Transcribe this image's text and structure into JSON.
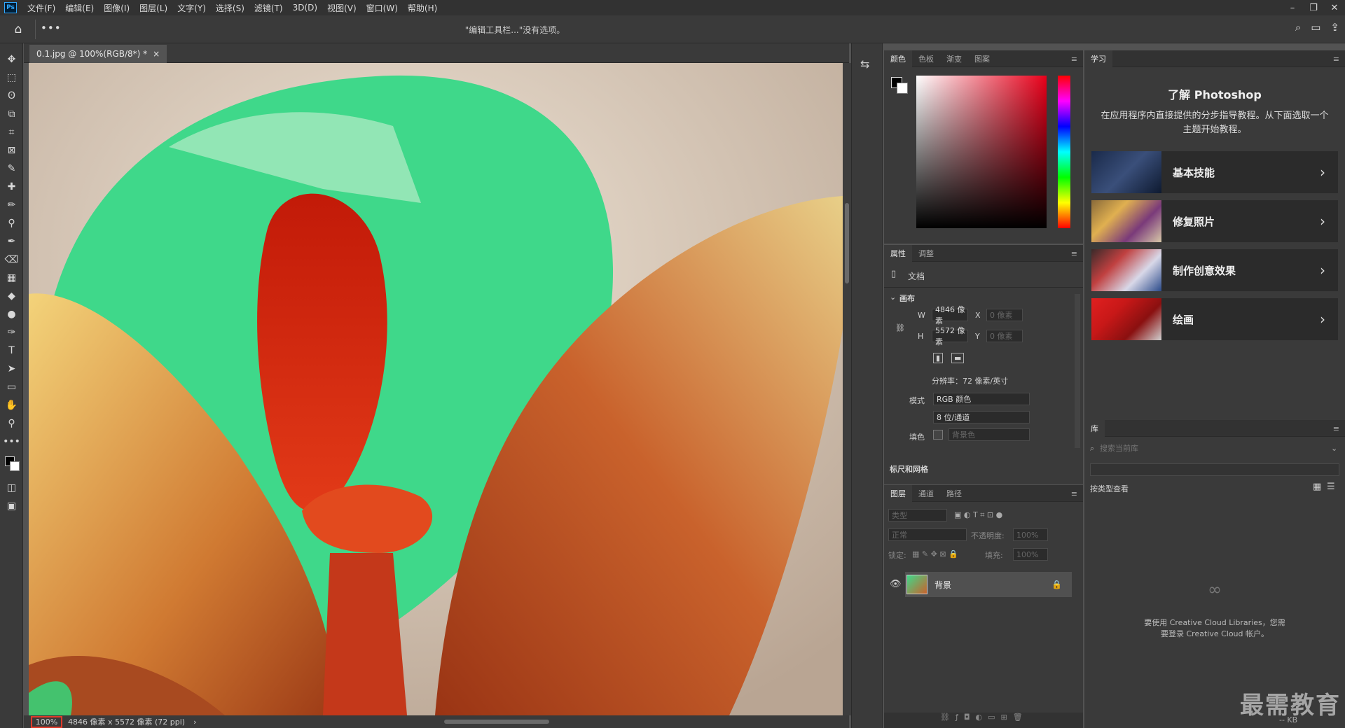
{
  "menubar": {
    "logo": "Ps",
    "items": [
      "文件(F)",
      "编辑(E)",
      "图像(I)",
      "图层(L)",
      "文字(Y)",
      "选择(S)",
      "滤镜(T)",
      "3D(D)",
      "视图(V)",
      "窗口(W)",
      "帮助(H)"
    ],
    "min": "–",
    "restore": "❐",
    "close": "✕"
  },
  "options": {
    "home": "⌂",
    "more": "•••",
    "message": "\"编辑工具栏...\"没有选项。"
  },
  "toolbar": {
    "tools": [
      "✥",
      "⬚",
      "ʘ",
      "⧉",
      "⌗",
      "⊠",
      "✎",
      "✚",
      "✏",
      "⚲",
      "✒",
      "⌫",
      "▦",
      "◆",
      "●",
      "✑",
      "T",
      "➤",
      "▭",
      "✋",
      "⚲",
      "•••"
    ]
  },
  "document": {
    "tab_label": "0.1.jpg @ 100%(RGB/8*) *",
    "tab_close": "×",
    "zoom": "100%",
    "info": "4846 像素 x 5572 像素 (72 ppi)",
    "info_arrow": "›"
  },
  "color_panel": {
    "tabs": [
      "颜色",
      "色板",
      "渐变",
      "图案"
    ],
    "menu": "≡"
  },
  "properties_panel": {
    "tabs": [
      "属性",
      "调整"
    ],
    "doc_label": "文档",
    "canvas_label": "画布",
    "w_label": "W",
    "w_value": "4846 像素",
    "h_label": "H",
    "h_value": "5572 像素",
    "x_label": "X",
    "x_value": "0 像素",
    "y_label": "Y",
    "y_value": "0 像素",
    "resolution": "分辨率：72 像素/英寸",
    "mode_label": "模式",
    "mode_value": "RGB 颜色",
    "depth_value": "8 位/通道",
    "fill_label": "填色",
    "fill_value": "背景色",
    "next_section": "标尺和网格"
  },
  "layers_panel": {
    "tabs": [
      "图层",
      "通道",
      "路径"
    ],
    "filter": "类型",
    "blend": "正常",
    "opacity_label": "不透明度:",
    "opacity": "100%",
    "lock_label": "锁定:",
    "fill_label": "填充:",
    "fill": "100%",
    "layer_name": "背景"
  },
  "learn_panel": {
    "tab": "学习",
    "title": "了解 Photoshop",
    "desc": "在应用程序内直接提供的分步指导教程。从下面选取一个主题开始教程。",
    "cards": [
      {
        "label": "基本技能"
      },
      {
        "label": "修复照片"
      },
      {
        "label": "制作创意效果"
      },
      {
        "label": "绘画"
      }
    ]
  },
  "library_panel": {
    "tab": "库",
    "search_placeholder": "搜索当前库",
    "view_by": "按类型查看",
    "cc_message": "要使用 Creative Cloud Libraries，您需要登录 Creative Cloud 帐户。",
    "kb": "-- KB"
  },
  "watermark": "最需教育"
}
